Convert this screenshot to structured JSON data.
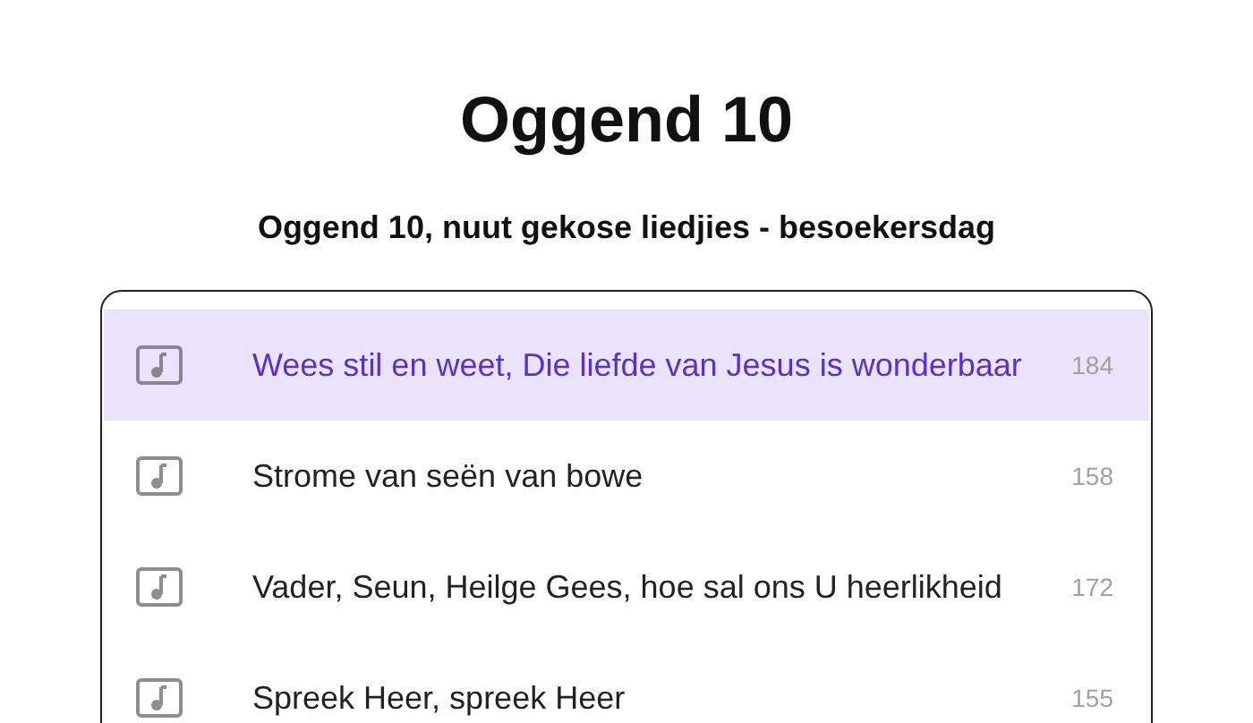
{
  "title": "Oggend 10",
  "subtitle": "Oggend 10, nuut gekose liedjies - besoekersdag",
  "songs": [
    {
      "title": "Wees stil en weet, Die liefde van Jesus is wonderbaar",
      "number": "184",
      "selected": true
    },
    {
      "title": "Strome van seën van bowe",
      "number": "158",
      "selected": false
    },
    {
      "title": "Vader, Seun, Heilge Gees, hoe sal ons U heerlikheid",
      "number": "172",
      "selected": false
    },
    {
      "title": "Spreek Heer, spreek Heer",
      "number": "155",
      "selected": false
    }
  ]
}
